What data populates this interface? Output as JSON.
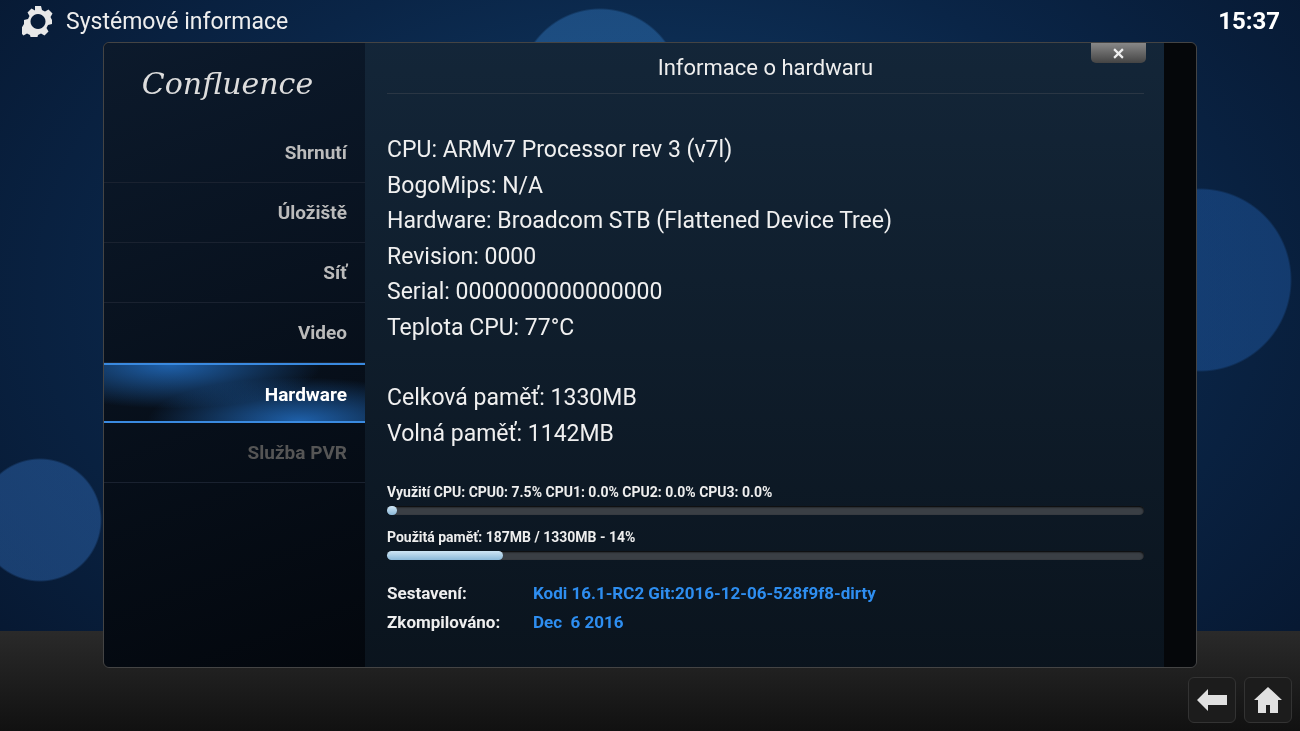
{
  "header": {
    "title": "Systémové informace",
    "clock": "15:37"
  },
  "dialog": {
    "logo": "Confluence",
    "title": "Informace o hardwaru",
    "sidebar": {
      "items": [
        {
          "label": "Shrnutí",
          "selected": false,
          "disabled": false
        },
        {
          "label": "Úložiště",
          "selected": false,
          "disabled": false
        },
        {
          "label": "Síť",
          "selected": false,
          "disabled": false
        },
        {
          "label": "Video",
          "selected": false,
          "disabled": false
        },
        {
          "label": "Hardware",
          "selected": true,
          "disabled": false
        },
        {
          "label": "Služba PVR",
          "selected": false,
          "disabled": true
        }
      ]
    },
    "info_groups": [
      [
        "CPU: ARMv7 Processor rev 3 (v7l)",
        "BogoMips: N/A",
        "Hardware: Broadcom STB (Flattened Device Tree)",
        "Revision: 0000",
        "Serial: 0000000000000000",
        "Teplota CPU: 77°C"
      ],
      [
        "Celková paměť: 1330MB",
        "Volná paměť: 1142MB"
      ]
    ],
    "meters": [
      {
        "label": "Využití CPU: CPU0: 7.5% CPU1: 0.0% CPU2: 0.0% CPU3: 0.0%",
        "level": 0.0
      },
      {
        "label": "Použitá paměť: 187MB / 1330MB - 14%",
        "level": 0.14
      }
    ],
    "build": [
      {
        "label": "Sestavení:",
        "value": "Kodi 16.1-RC2 Git:2016-12-06-528f9f8-dirty"
      },
      {
        "label": "Zkompilováno:",
        "value": "Dec  6 2016"
      }
    ]
  }
}
